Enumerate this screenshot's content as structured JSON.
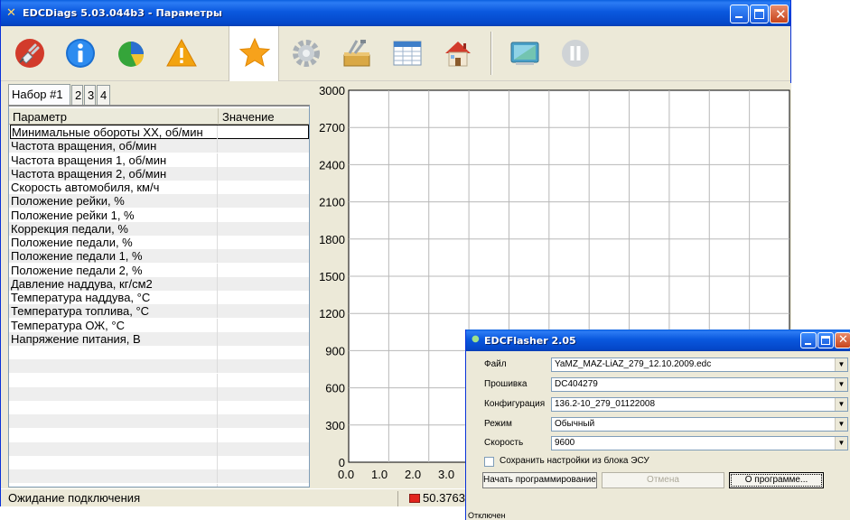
{
  "main_window": {
    "title": "EDCDiags 5.03.044b3 - Параметры",
    "toolbar": [
      {
        "name": "connect",
        "icon": "plug-icon"
      },
      {
        "name": "info",
        "icon": "info-icon"
      },
      {
        "name": "diagnostics",
        "icon": "pie-icon"
      },
      {
        "name": "errors",
        "icon": "warning-icon"
      },
      {
        "name": "parameters",
        "icon": "star-icon"
      },
      {
        "name": "settings",
        "icon": "gear-icon"
      },
      {
        "name": "tools",
        "icon": "tools-icon"
      },
      {
        "name": "table",
        "icon": "table-icon"
      },
      {
        "name": "home",
        "icon": "house-icon"
      },
      {
        "name": "record",
        "icon": "screen-icon"
      },
      {
        "name": "pause",
        "icon": "pause-icon"
      }
    ]
  },
  "tabs": [
    "Набор #1",
    "2",
    "3",
    "4"
  ],
  "grid": {
    "headers": [
      "Параметр",
      "Значение"
    ],
    "rows": [
      "Минимальные обороты ХХ, об/мин",
      "Частота вращения, об/мин",
      "Частота вращения 1, об/мин",
      "Частота вращения 2, об/мин",
      "Скорость автомобиля, км/ч",
      "Положение рейки, %",
      "Положение рейки 1, %",
      "Коррекция педали, %",
      "Положение педали, %",
      "Положение педали 1, %",
      "Положение педали 2, %",
      "Давление наддува, кг/см2",
      "Температура наддува, °С",
      "Температура топлива, °С",
      "Температура ОЖ, °С",
      "Напряжение питания, В"
    ]
  },
  "chart_data": {
    "type": "line",
    "title": "",
    "xlabel": "",
    "ylabel": "",
    "y_ticks": [
      "3000",
      "2700",
      "2400",
      "2100",
      "1800",
      "1500",
      "1200",
      "900",
      "600",
      "300",
      "0"
    ],
    "x_ticks": [
      "0.0",
      "1.0",
      "2.0",
      "3.0"
    ],
    "ylim": [
      0,
      3000
    ],
    "grid": true,
    "series": []
  },
  "status": {
    "text": "Ожидание подключения",
    "value": "50.3763",
    "led_color": "#e2241c"
  },
  "flasher": {
    "title": "EDCFlasher 2.05",
    "fields": [
      {
        "label": "Файл",
        "value": "YaMZ_MAZ-LiAZ_279_12.10.2009.edc"
      },
      {
        "label": "Прошивка",
        "value": "DC404279"
      },
      {
        "label": "Конфигурация",
        "value": "136.2-10_279_01122008"
      },
      {
        "label": "Режим",
        "value": "Обычный"
      },
      {
        "label": "Скорость",
        "value": "9600"
      }
    ],
    "checkbox_label": "Сохранить настройки из блока ЭСУ",
    "buttons": {
      "start": "Начать программирование",
      "cancel": "Отмена",
      "about": "О программе..."
    },
    "status": "Отключен"
  }
}
